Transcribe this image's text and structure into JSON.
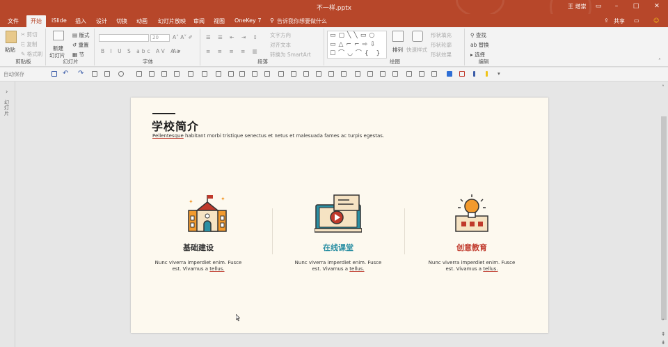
{
  "window": {
    "document_title": "不一样.pptx",
    "user": "王 增崇"
  },
  "menu": {
    "items": [
      "文件",
      "开始",
      "iSlide",
      "插入",
      "设计",
      "切换",
      "动画",
      "幻灯片放映",
      "审阅",
      "视图",
      "OneKey 7"
    ],
    "active_index": 1,
    "tell_me": "告诉我你想要做什么",
    "share": "共享"
  },
  "ribbon": {
    "clipboard": {
      "paste": "粘贴",
      "cut": "剪切",
      "copy": "复制",
      "format_painter": "格式刷",
      "label": "剪贴板"
    },
    "slides": {
      "new_slide": "新建",
      "new_slide2": "幻灯片",
      "layout": "版式",
      "reset": "重置",
      "section": "节",
      "label": "幻灯片"
    },
    "font": {
      "font_name": "",
      "font_size": "20",
      "label": "字体"
    },
    "paragraph": {
      "text_direction": "文字方向",
      "align_text": "对齐文本",
      "smartart": "转换为 SmartArt",
      "label": "段落"
    },
    "drawing": {
      "arrange": "排列",
      "quick_styles": "快速样式",
      "shape_fill": "形状填充",
      "shape_outline": "形状轮廓",
      "shape_effects": "形状效果",
      "label": "绘图"
    },
    "editing": {
      "find": "查找",
      "replace": "替换",
      "select": "选择",
      "label": "编辑"
    }
  },
  "qat": {
    "autosave": "自动保存"
  },
  "left_pane": {
    "label": "幻灯片"
  },
  "slide": {
    "title": "学校简介",
    "subtitle_underlined": "Pellentesque",
    "subtitle_rest": " habitant morbi tristique senectus et netus et malesuada fames ac turpis egestas.",
    "columns": [
      {
        "title": "基础建设",
        "color": "#333333",
        "desc_line1": "Nunc viverra imperdiet enim. Fusce",
        "desc_line2": "est. Vivamus a ",
        "desc_link": "tellus."
      },
      {
        "title": "在线课堂",
        "color": "#2b8fa3",
        "desc_line1": "Nunc viverra imperdiet enim. Fusce",
        "desc_line2": "est. Vivamus a ",
        "desc_link": "tellus."
      },
      {
        "title": "创意教育",
        "color": "#c0392b",
        "desc_line1": "Nunc viverra imperdiet enim. Fusce",
        "desc_line2": "est. Vivamus a ",
        "desc_link": "tellus."
      }
    ]
  },
  "colors": {
    "accent": "#b7472a",
    "slide_bg": "#fdf9ef",
    "icon_orange": "#f29a2e",
    "icon_teal": "#2b8fa3",
    "icon_red": "#c0392b"
  }
}
